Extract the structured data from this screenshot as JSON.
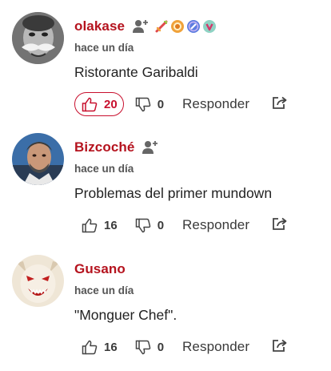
{
  "colors": {
    "author": "#b5131e",
    "like_active": "#c8102e",
    "meta": "#555555"
  },
  "comments": [
    {
      "author": "olakase",
      "time": "hace un día",
      "text": "Ristorante Garibaldi",
      "likes": "20",
      "dislikes": "0",
      "reply_label": "Responder",
      "liked": true,
      "badges": [
        "sword-badge-icon",
        "medal-badge-icon",
        "shield-badge-icon",
        "heart-badge-icon"
      ]
    },
    {
      "author": "Bizcoché",
      "time": "hace un día",
      "text": "Problemas del primer mundown",
      "likes": "16",
      "dislikes": "0",
      "reply_label": "Responder",
      "liked": false
    },
    {
      "author": "Gusano",
      "time": "hace un día",
      "text": "\"Monguer Chef\".",
      "likes": "16",
      "dislikes": "0",
      "reply_label": "Responder",
      "liked": false
    }
  ]
}
